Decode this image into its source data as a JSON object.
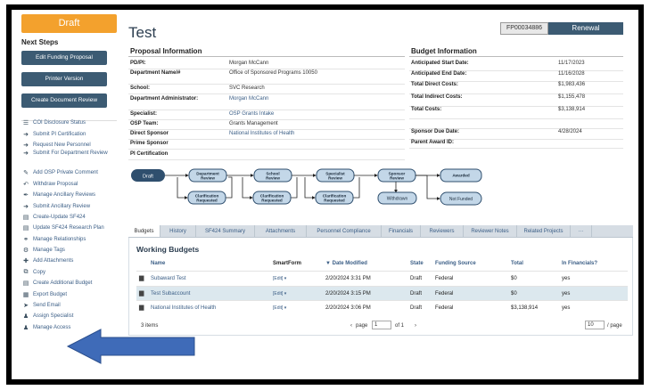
{
  "status_tab": "Draft",
  "next_steps_label": "Next Steps",
  "actions": [
    "Edit Funding Proposal",
    "Printer Version",
    "Create Document Review"
  ],
  "steps": [
    {
      "icon": "list-icon",
      "glyph": "☰",
      "label": "COI Disclosure Status"
    },
    {
      "icon": "arrow-right-icon",
      "glyph": "➜",
      "label": "Submit PI Certification"
    },
    {
      "icon": "arrow-right-icon",
      "glyph": "➜",
      "label": "Request New Personnel"
    },
    {
      "icon": "arrow-right-icon",
      "glyph": "➜",
      "label": "Submit For Department Review",
      "tall": true
    },
    {
      "icon": "comment-icon",
      "glyph": "✎",
      "label": "Add OSP Private Comment"
    },
    {
      "icon": "undo-icon",
      "glyph": "↶",
      "label": "Withdraw Proposal"
    },
    {
      "icon": "wrench-icon",
      "glyph": "✒",
      "label": "Manage Ancillary Reviews"
    },
    {
      "icon": "arrow-right-icon",
      "glyph": "➜",
      "label": "Submit Ancillary Review"
    },
    {
      "icon": "document-icon",
      "glyph": "▤",
      "label": "Create-Update SF424"
    },
    {
      "icon": "document-icon",
      "glyph": "▤",
      "label": "Update SF424 Research Plan"
    },
    {
      "icon": "link-icon",
      "glyph": "⚭",
      "label": "Manage Relationships"
    },
    {
      "icon": "gear-icon",
      "glyph": "⚙",
      "label": "Manage Tags"
    },
    {
      "icon": "plus-icon",
      "glyph": "✚",
      "label": "Add Attachments"
    },
    {
      "icon": "copy-icon",
      "glyph": "⧉",
      "label": "Copy"
    },
    {
      "icon": "document-icon",
      "glyph": "▤",
      "label": "Create Additional Budget"
    },
    {
      "icon": "export-icon",
      "glyph": "▦",
      "label": "Export Budget"
    },
    {
      "icon": "send-icon",
      "glyph": "➤",
      "label": "Send Email"
    },
    {
      "icon": "user-icon",
      "glyph": "♟",
      "label": "Assign Specialist"
    },
    {
      "icon": "users-icon",
      "glyph": "♟",
      "label": "Manage Access"
    }
  ],
  "title": "Test",
  "id_badge": "FP00034886",
  "type_badge": "Renewal",
  "proposal_info": {
    "heading": "Proposal Information",
    "rows": [
      {
        "k": "PD/PI:",
        "v": "Morgan McCann",
        "link": false
      },
      {
        "k": "Department Name/#",
        "v": "Office of Sponsored Programs 10050",
        "link": false,
        "tall": true
      },
      {
        "k": "School:",
        "v": "SVC Research",
        "link": false
      },
      {
        "k": "Department Administrator:",
        "v": "Morgan McCann",
        "link": true,
        "tall": true
      },
      {
        "k": "Specialist:",
        "v": "OSP Grants Intake",
        "link": true
      },
      {
        "k": "OSP Team:",
        "v": "Grants Management",
        "link": false
      },
      {
        "k": "Direct Sponsor",
        "v": "National Institutes of Health",
        "link": true
      },
      {
        "k": "Prime Sponsor",
        "v": "",
        "link": false
      },
      {
        "k": "PI Certification",
        "v": "",
        "link": false
      }
    ]
  },
  "budget_info": {
    "heading": "Budget Information",
    "rows": [
      {
        "k": "Anticipated Start Date:",
        "v": "11/17/2023"
      },
      {
        "k": "Anticipated End Date:",
        "v": "11/16/2028"
      },
      {
        "k": "Total Direct Costs:",
        "v": "$1,983,436"
      },
      {
        "k": "Total Indirect Costs:",
        "v": "$1,155,478"
      },
      {
        "k": "Total Costs:",
        "v": "$3,138,914"
      },
      {
        "k": "",
        "v": ""
      },
      {
        "k": "Sponsor Due Date:",
        "v": "4/28/2024"
      },
      {
        "k": "Parent Award ID:",
        "v": ""
      }
    ]
  },
  "workflow": {
    "draft": "Draft",
    "nodes": [
      "Department Review",
      "School Review",
      "Specialist Review",
      "Sponsor Review",
      "Awarded"
    ],
    "clarifications": [
      "Clarification Requested",
      "Clarification Requested",
      "Clarification Requested"
    ],
    "withdrawn": "Withdrawn",
    "not_funded": "Not Funded"
  },
  "tabs": [
    "Budgets",
    "History",
    "SF424 Summary",
    "Attachments",
    "Personnel Compliance",
    "Financials",
    "Reviewers",
    "Reviewer Notes",
    "Related Projects",
    "···"
  ],
  "working_budgets": {
    "heading": "Working Budgets",
    "columns": [
      "Name",
      "SmartForm",
      "▼ Date Modified",
      "State",
      "Funding Source",
      "Total",
      "In Financials?"
    ],
    "rows": [
      {
        "name": "Subaward Test",
        "smartform": "[Edit] ▾",
        "date": "2/20/2024 3:31 PM",
        "state": "Draft",
        "source": "Federal",
        "total": "$0",
        "fin": "yes"
      },
      {
        "name": "Test Subaccount",
        "smartform": "[Edit] ▾",
        "date": "2/20/2024 3:15 PM",
        "state": "Draft",
        "source": "Federal",
        "total": "$0",
        "fin": "yes"
      },
      {
        "name": "National Institutes of Health",
        "smartform": "[Edit] ▾",
        "date": "2/20/2024 3:06 PM",
        "state": "Draft",
        "source": "Federal",
        "total": "$3,138,914",
        "fin": "yes"
      }
    ],
    "items": "3 items",
    "page_prefix": "page",
    "page_value": "1",
    "page_of": "of 1",
    "per_page_value": "10",
    "per_page_suffix": "/ page"
  },
  "colors": {
    "accent": "#f3a12d",
    "button": "#3c5b73",
    "link": "#3b5e86",
    "arrow": "#3f6bb8"
  }
}
